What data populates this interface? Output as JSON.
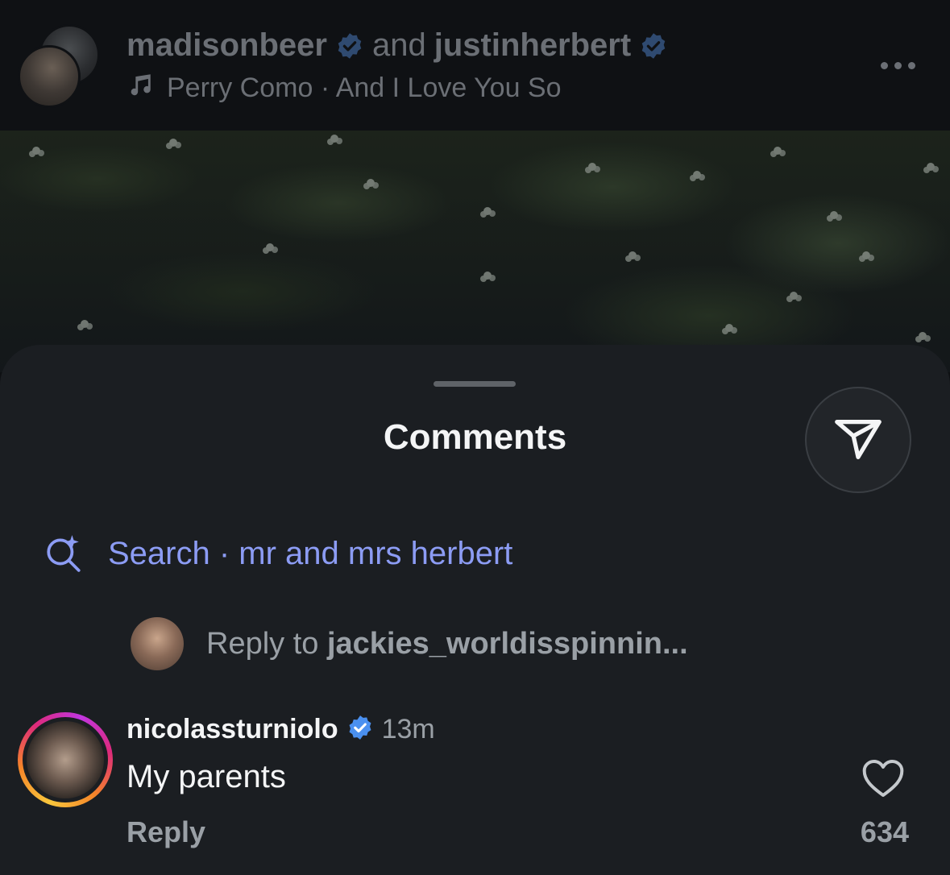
{
  "header": {
    "user1": "madisonbeer",
    "conjunction": "and",
    "user2": "justinherbert",
    "music": "Perry Como · And I Love You So",
    "icons": [
      "music-note-icon",
      "verified-badge-icon",
      "more-icon"
    ]
  },
  "sheet": {
    "title": "Comments",
    "share_icon": "send-icon",
    "search": {
      "label": "Search · mr and mrs herbert",
      "icon": "ai-search-icon"
    },
    "reply_to": {
      "prefix": "Reply to ",
      "user": "jackies_worldisspinnin..."
    },
    "comment": {
      "username": "nicolassturniolo",
      "time": "13m",
      "text": "My parents",
      "reply_label": "Reply",
      "likes": "634"
    }
  },
  "colors": {
    "accent_blue": "#8c9cf4",
    "verified_blue": "#4a90f0",
    "sheet_bg": "#1b1e22"
  }
}
